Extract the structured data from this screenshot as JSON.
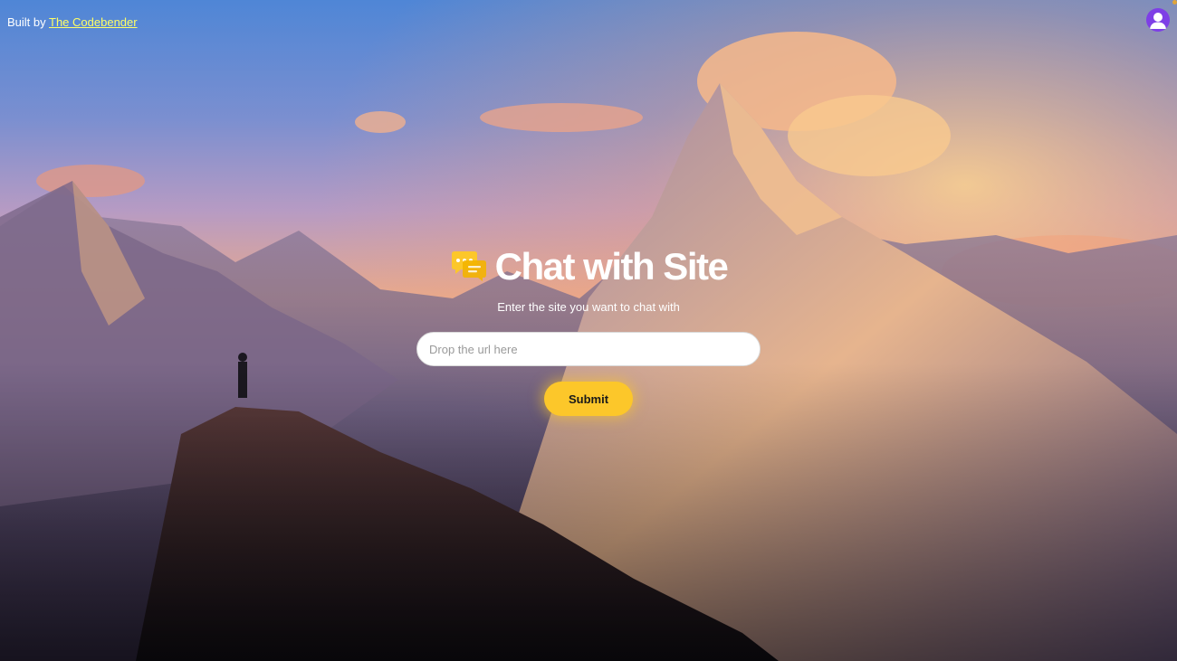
{
  "credit": {
    "prefix": "Built by ",
    "link_text": "The Codebender"
  },
  "user": {
    "avatar_icon": "user-avatar-icon",
    "status_color": "#e0a53b"
  },
  "hero": {
    "title": "Chat with Site",
    "logo_icon": "chat-bubbles-icon",
    "subtitle": "Enter the site you want to chat with"
  },
  "url_form": {
    "value": "",
    "placeholder": "Drop the url here",
    "submit_label": "Submit"
  },
  "colors": {
    "accent": "#fcc72a",
    "link": "#ffff66",
    "avatar": "#7e3fe6"
  }
}
